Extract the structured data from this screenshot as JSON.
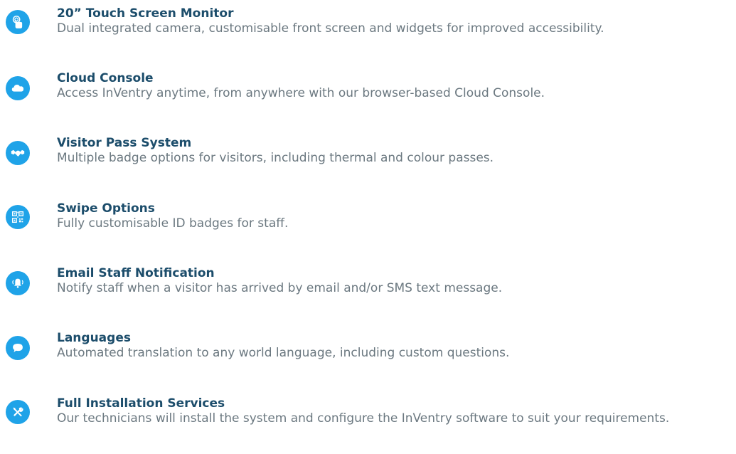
{
  "colors": {
    "accent": "#1fa3e8",
    "title": "#1c4d6b",
    "text": "#6b7880"
  },
  "features": [
    {
      "icon": "touch-screen-icon",
      "title": "20” Touch Screen Monitor",
      "description": "Dual integrated camera, customisable front screen and widgets for improved accessibility."
    },
    {
      "icon": "cloud-icon",
      "title": "Cloud Console",
      "description": "Access InVentry anytime, from anywhere with our browser-based Cloud Console."
    },
    {
      "icon": "handshake-icon",
      "title": "Visitor Pass System",
      "description": "Multiple badge options for visitors, including thermal and colour passes."
    },
    {
      "icon": "qr-code-icon",
      "title": "Swipe Options",
      "description": "Fully customisable ID badges for staff."
    },
    {
      "icon": "bell-icon",
      "title": "Email Staff Notification",
      "description": "Notify staff when a visitor has arrived by email and/or SMS text message."
    },
    {
      "icon": "speech-bubble-icon",
      "title": "Languages",
      "description": "Automated translation to any world language, including custom questions."
    },
    {
      "icon": "tools-icon",
      "title": "Full Installation Services",
      "description": "Our technicians will install the system and configure the InVentry software to suit your requirements."
    }
  ]
}
